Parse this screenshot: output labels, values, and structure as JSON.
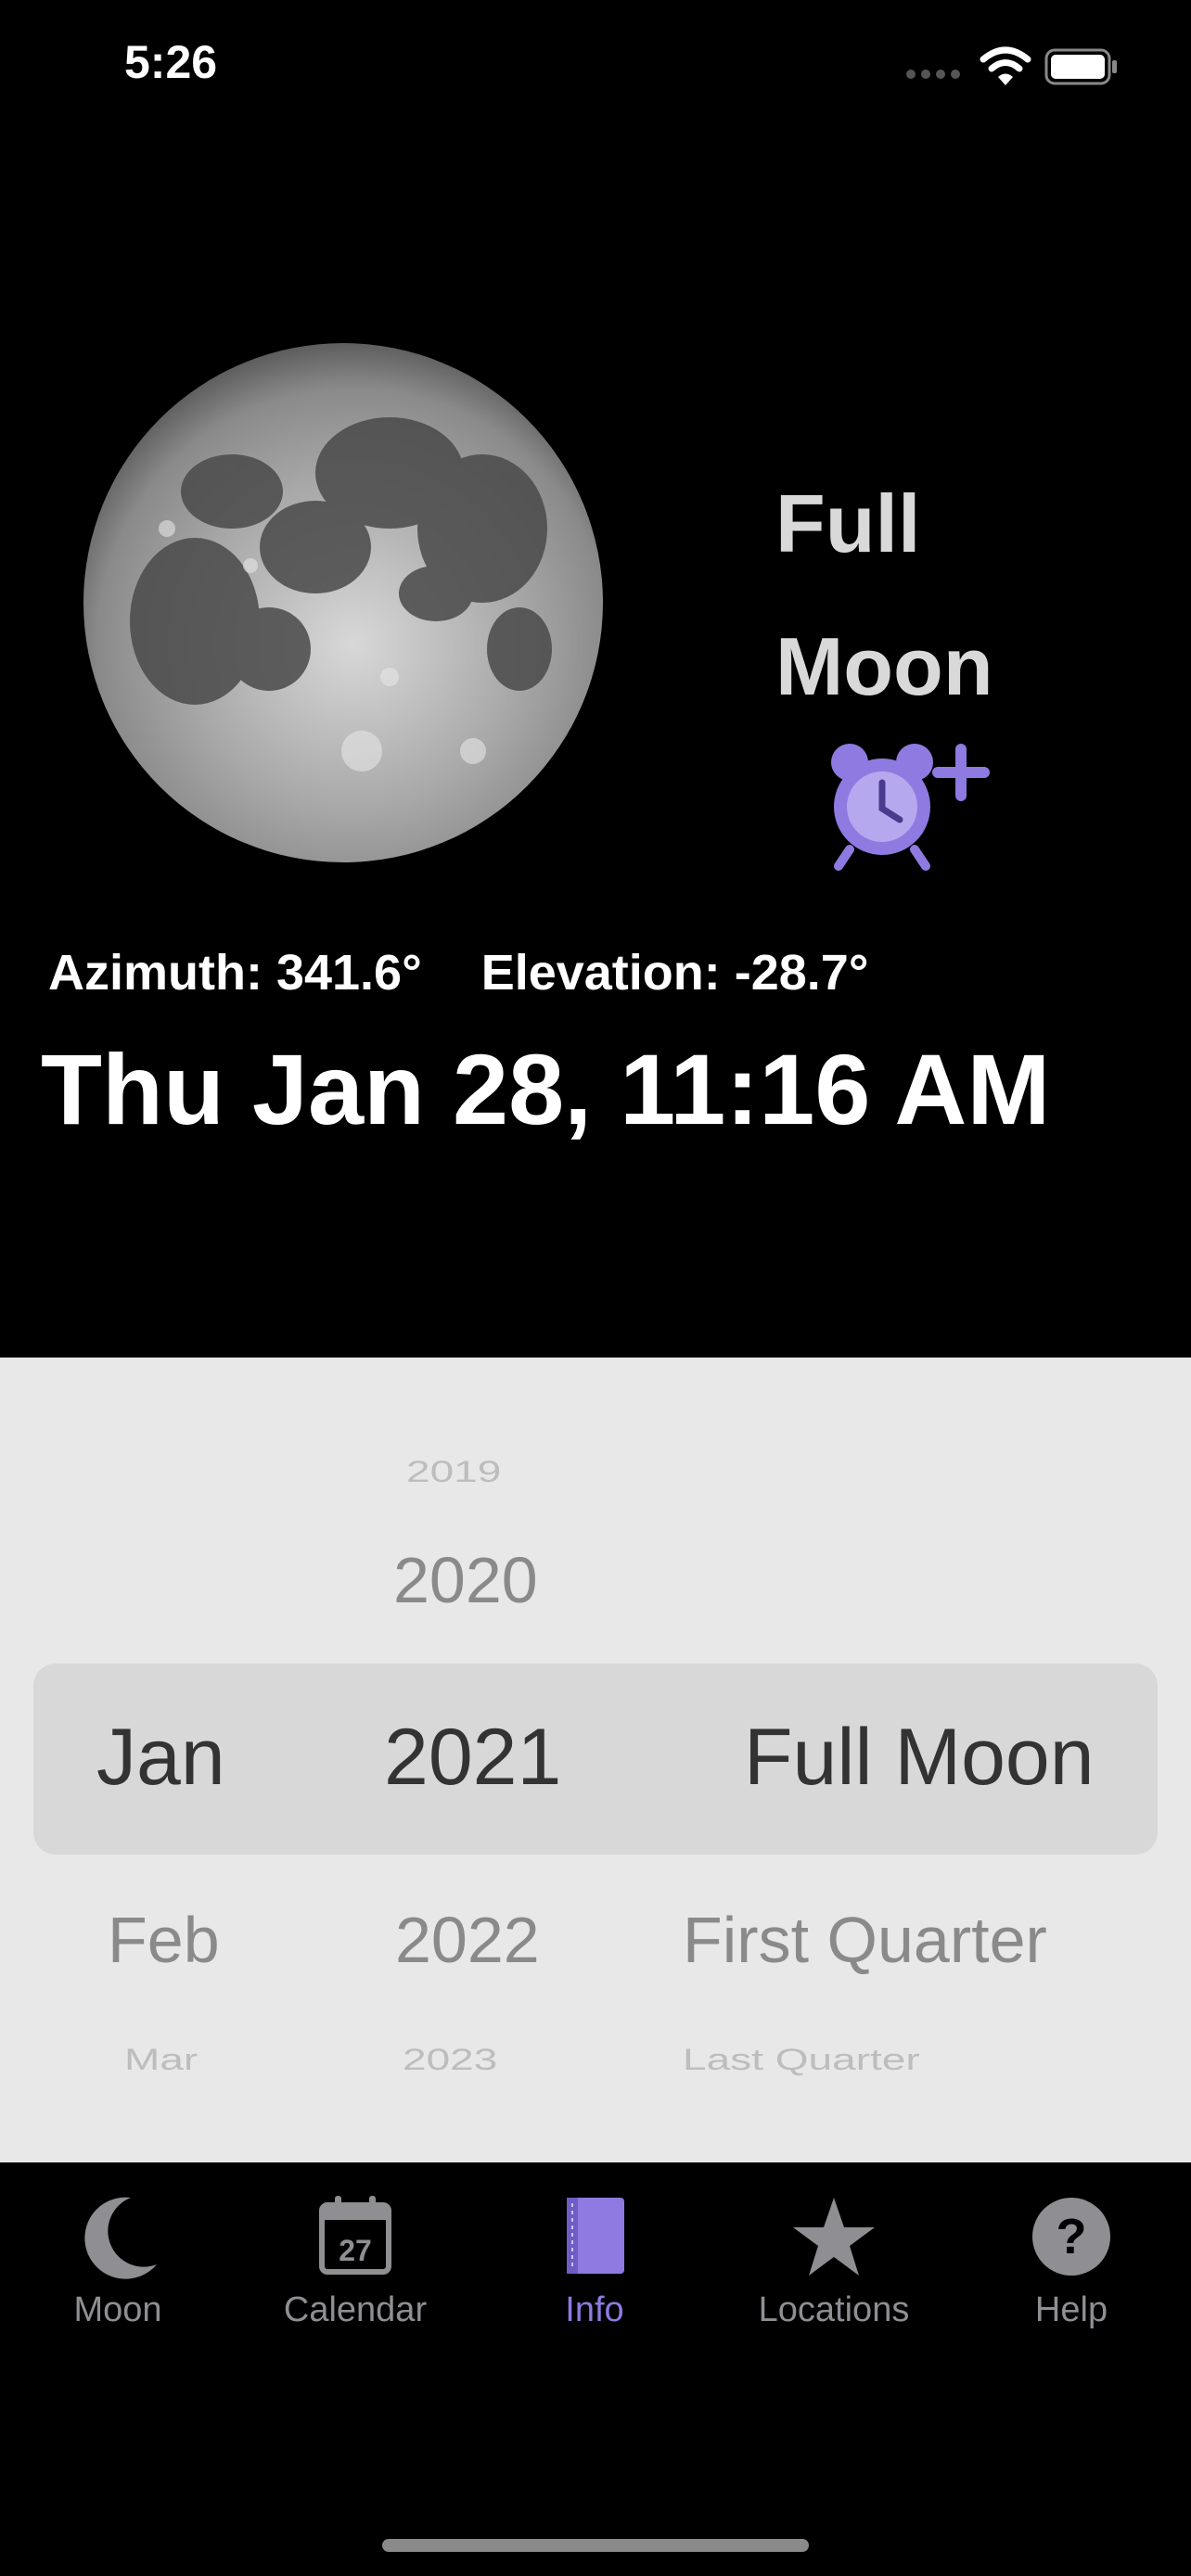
{
  "status_bar": {
    "time": "5:26",
    "icons": [
      "signal-dots-icon",
      "wifi-icon",
      "battery-icon"
    ]
  },
  "moon": {
    "phase_line1": "Full",
    "phase_line2": "Moon",
    "azimuth": "Azimuth: 341.6°",
    "elevation": "Elevation: -28.7°",
    "datetime": "Thu Jan 28, 11:16 AM",
    "alarm_icon": "alarm-add-icon"
  },
  "picker": {
    "months": {
      "selected": "Jan",
      "below1": "Feb",
      "below2": "Mar"
    },
    "years": {
      "above2": "2019",
      "above1": "2020",
      "selected": "2021",
      "below1": "2022",
      "below2": "2023"
    },
    "phases": {
      "selected": "Full Moon",
      "below1": "First Quarter",
      "below2": "Last Quarter"
    }
  },
  "tabs": [
    {
      "label": "Moon",
      "icon": "crescent-moon-icon"
    },
    {
      "label": "Calendar",
      "icon": "calendar-icon",
      "day": "27"
    },
    {
      "label": "Info",
      "icon": "book-icon",
      "active": true
    },
    {
      "label": "Locations",
      "icon": "star-icon"
    },
    {
      "label": "Help",
      "icon": "question-mark-icon"
    }
  ],
  "colors": {
    "accent": "#8e7ae0",
    "inactive": "#8e8e93",
    "picker_bg": "#e8e8e8"
  }
}
